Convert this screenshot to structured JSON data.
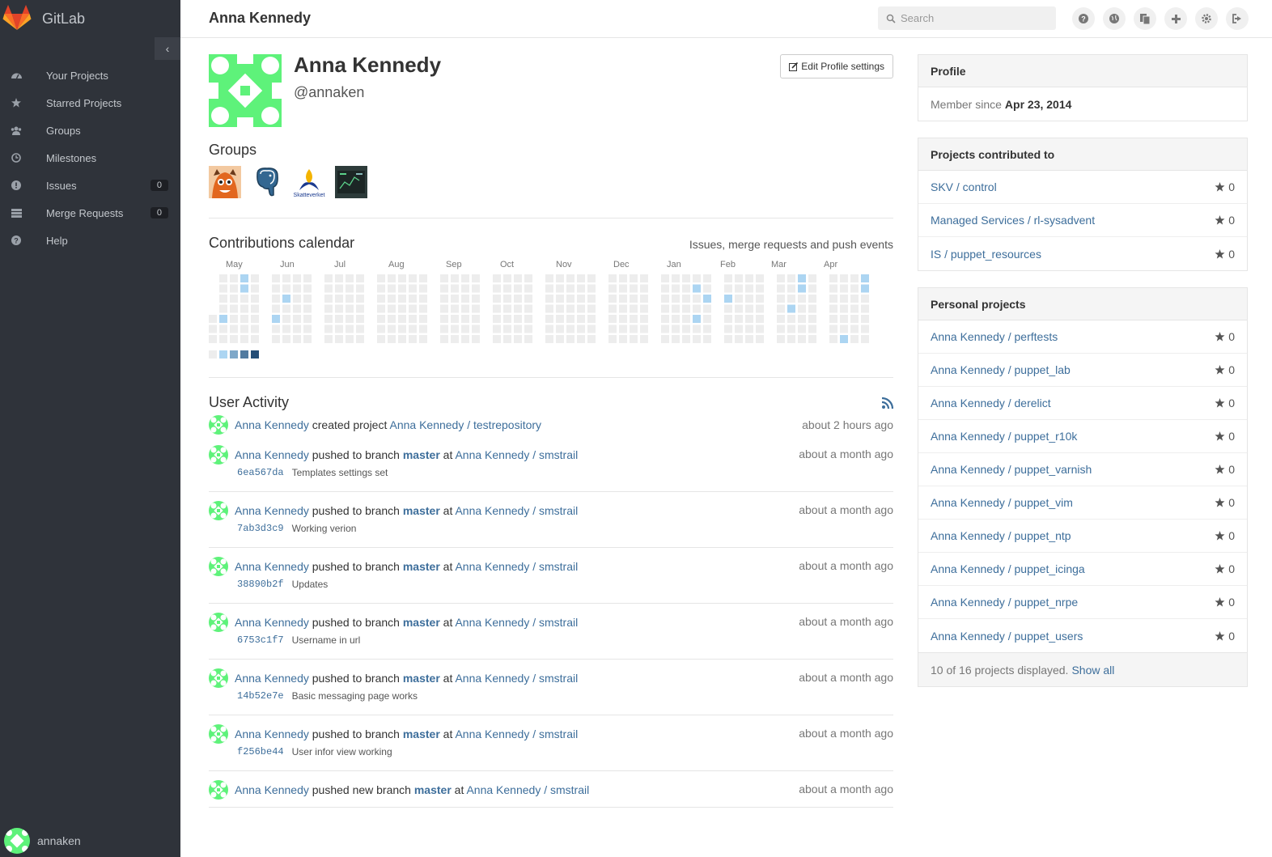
{
  "app": {
    "name": "GitLab"
  },
  "sidebar": {
    "items": [
      {
        "label": "Your Projects",
        "icon": "dashboard-icon"
      },
      {
        "label": "Starred Projects",
        "icon": "star-icon"
      },
      {
        "label": "Groups",
        "icon": "users-icon"
      },
      {
        "label": "Milestones",
        "icon": "clock-icon"
      },
      {
        "label": "Issues",
        "icon": "exclamation-icon",
        "count": "0"
      },
      {
        "label": "Merge Requests",
        "icon": "list-icon",
        "count": "0"
      },
      {
        "label": "Help",
        "icon": "question-icon"
      }
    ],
    "username": "annaken"
  },
  "header": {
    "title": "Anna Kennedy",
    "search_placeholder": "Search",
    "icons": [
      "help-icon",
      "globe-icon",
      "copy-icon",
      "plus-icon",
      "gear-icon",
      "sign-out-icon"
    ]
  },
  "profile": {
    "name": "Anna Kennedy",
    "handle": "@annaken",
    "edit_label": "Edit Profile settings",
    "groups_title": "Groups",
    "groups": [
      "group-avatar-1",
      "group-avatar-postgres",
      "group-avatar-skatteverket",
      "group-avatar-4"
    ],
    "skatteverket_text": "Skatteverket"
  },
  "contributions": {
    "title": "Contributions calendar",
    "subtitle": "Issues, merge requests and push events",
    "months": [
      "May",
      "Jun",
      "Jul",
      "Aug",
      "Sep",
      "Oct",
      "Nov",
      "Dec",
      "Jan",
      "Feb",
      "Mar",
      "Apr"
    ],
    "legend_colors": [
      "#ededed",
      "#acd5f2",
      "#7fa8c9",
      "#527ba0",
      "#254e77"
    ],
    "active_color": "#acd5f2",
    "empty_color": "#ededed"
  },
  "activity": {
    "title": "User Activity",
    "events": [
      {
        "author": "Anna Kennedy",
        "action": "created project",
        "target": "Anna Kennedy / testrepository",
        "time": "about 2 hours ago"
      },
      {
        "author": "Anna Kennedy",
        "action": "pushed to branch",
        "branch": "master",
        "at": "at",
        "target": "Anna Kennedy / smstrail",
        "time": "about a month ago",
        "sha": "6ea567da",
        "message": "Templates settings set"
      },
      {
        "author": "Anna Kennedy",
        "action": "pushed to branch",
        "branch": "master",
        "at": "at",
        "target": "Anna Kennedy / smstrail",
        "time": "about a month ago",
        "sha": "7ab3d3c9",
        "message": "Working verion"
      },
      {
        "author": "Anna Kennedy",
        "action": "pushed to branch",
        "branch": "master",
        "at": "at",
        "target": "Anna Kennedy / smstrail",
        "time": "about a month ago",
        "sha": "38890b2f",
        "message": "Updates"
      },
      {
        "author": "Anna Kennedy",
        "action": "pushed to branch",
        "branch": "master",
        "at": "at",
        "target": "Anna Kennedy / smstrail",
        "time": "about a month ago",
        "sha": "6753c1f7",
        "message": "Username in url"
      },
      {
        "author": "Anna Kennedy",
        "action": "pushed to branch",
        "branch": "master",
        "at": "at",
        "target": "Anna Kennedy / smstrail",
        "time": "about a month ago",
        "sha": "14b52e7e",
        "message": "Basic messaging page works"
      },
      {
        "author": "Anna Kennedy",
        "action": "pushed to branch",
        "branch": "master",
        "at": "at",
        "target": "Anna Kennedy / smstrail",
        "time": "about a month ago",
        "sha": "f256be44",
        "message": "User infor view working"
      },
      {
        "author": "Anna Kennedy",
        "action": "pushed new branch",
        "branch": "master",
        "at": "at",
        "target": "Anna Kennedy / smstrail",
        "time": "about a month ago"
      }
    ]
  },
  "right": {
    "profile_title": "Profile",
    "member_since_label": "Member since",
    "member_since_date": "Apr 23, 2014",
    "contributed_title": "Projects contributed to",
    "contributed": [
      {
        "name": "SKV / control",
        "stars": "0"
      },
      {
        "name": "Managed Services / rl-sysadvent",
        "stars": "0"
      },
      {
        "name": "IS / puppet_resources",
        "stars": "0"
      }
    ],
    "personal_title": "Personal projects",
    "personal": [
      {
        "name": "Anna Kennedy / perftests",
        "stars": "0"
      },
      {
        "name": "Anna Kennedy / puppet_lab",
        "stars": "0"
      },
      {
        "name": "Anna Kennedy / derelict",
        "stars": "0"
      },
      {
        "name": "Anna Kennedy / puppet_r10k",
        "stars": "0"
      },
      {
        "name": "Anna Kennedy / puppet_varnish",
        "stars": "0"
      },
      {
        "name": "Anna Kennedy / puppet_vim",
        "stars": "0"
      },
      {
        "name": "Anna Kennedy / puppet_ntp",
        "stars": "0"
      },
      {
        "name": "Anna Kennedy / puppet_icinga",
        "stars": "0"
      },
      {
        "name": "Anna Kennedy / puppet_nrpe",
        "stars": "0"
      },
      {
        "name": "Anna Kennedy / puppet_users",
        "stars": "0"
      }
    ],
    "footer_text": "10 of 16 projects displayed.",
    "show_all": "Show all"
  }
}
